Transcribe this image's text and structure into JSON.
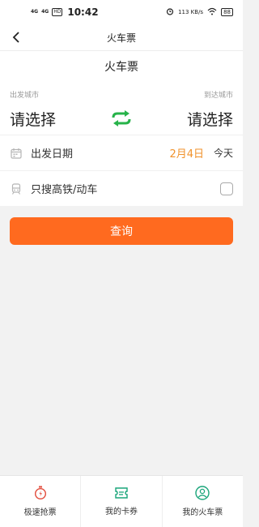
{
  "status_bar": {
    "signal_1": "4G",
    "signal_2": "4G",
    "hd_badge": "HD",
    "time": "10:42",
    "net_speed": "113 KB/s",
    "battery": "88"
  },
  "navbar": {
    "title": "火车票"
  },
  "card": {
    "title": "火车票",
    "from_label": "出发城市",
    "to_label": "到达城市",
    "from_city": "请选择",
    "to_city": "请选择",
    "date_label": "出发日期",
    "date_value": "2月4日",
    "date_day": "今天",
    "high_speed_label": "只搜高铁/动车",
    "high_speed_checked": false
  },
  "search_button": "查询",
  "tabbar": [
    {
      "label": "极速抢票",
      "icon": "stopwatch-icon"
    },
    {
      "label": "我的卡券",
      "icon": "ticket-coupon-icon"
    },
    {
      "label": "我的火车票",
      "icon": "user-circle-icon"
    }
  ],
  "colors": {
    "accent": "#ff6a1f",
    "date": "#f0922b",
    "swap_green": "#27b34a",
    "tab_icon": "#e24b3b",
    "tab_icon_green": "#1aa57a"
  }
}
